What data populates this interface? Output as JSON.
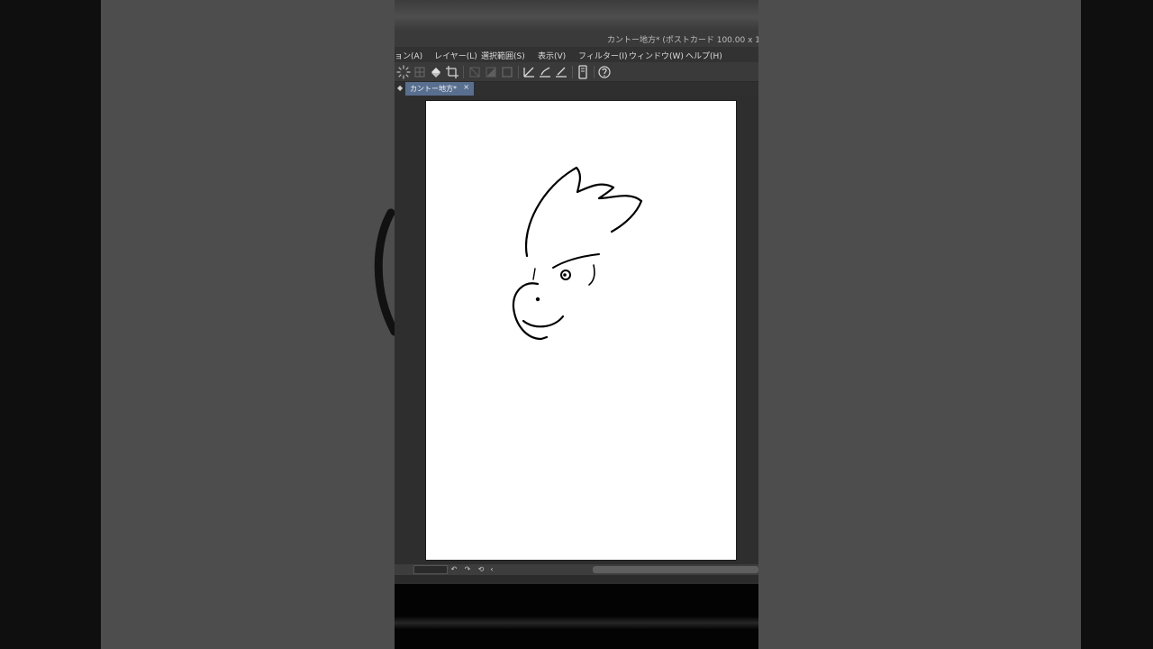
{
  "window": {
    "title": "カントー地方* (ポストカード 100.00 x 1"
  },
  "menu": {
    "items": [
      {
        "label": "ョン(A)"
      },
      {
        "label": "レイヤー(L)"
      },
      {
        "label": "選択範囲(S)"
      },
      {
        "label": "表示(V)"
      },
      {
        "label": "フィルター(I)"
      },
      {
        "label": "ウィンドウ(W)"
      },
      {
        "label": "ヘルプ(H)"
      }
    ]
  },
  "toolbar": {
    "icons": [
      "sparkle-select-icon",
      "grid-select-icon",
      "fill-bucket-icon",
      "crop-transform-icon",
      "clear-outside-icon",
      "fill-selection-icon",
      "stroke-selection-icon",
      "ruler-icon",
      "brush-ruler-icon",
      "pen-ruler-icon",
      "device-icon",
      "help-icon"
    ]
  },
  "document_tab": {
    "label": "カントー地方*",
    "close_symbol": "×",
    "pin_symbol": "◆"
  },
  "statusbar": {
    "icons": [
      "undo-icon",
      "redo-icon",
      "rotate-icon",
      "more-icon"
    ],
    "glyphs": [
      "↶",
      "↷",
      "⟲",
      "‹"
    ]
  },
  "colors": {
    "tab_active": "#596f8f",
    "canvas_bg": "#2e2e2e",
    "paper": "#ffffff",
    "stroke": "#000000"
  }
}
